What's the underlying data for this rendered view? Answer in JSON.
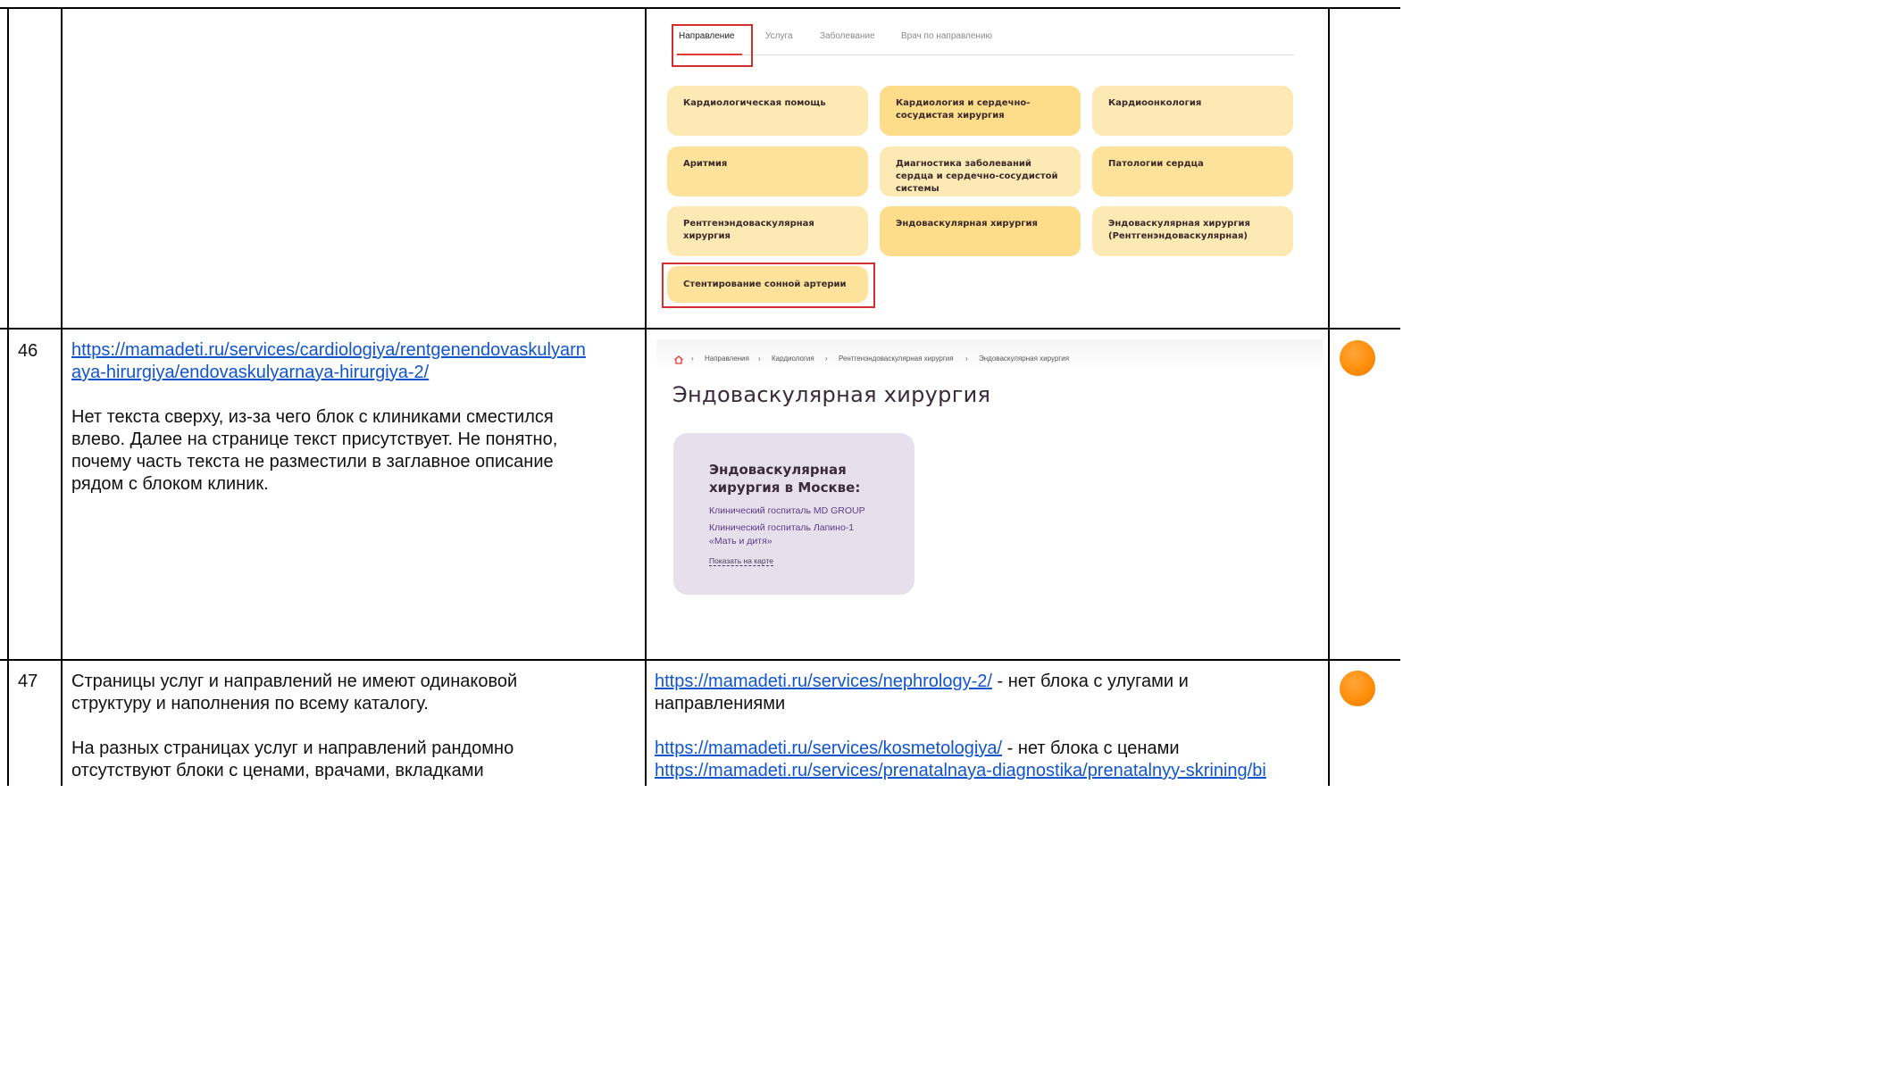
{
  "row_top": {
    "tabs": [
      "Направление",
      "Услуга",
      "Заболевание",
      "Врач по направлению"
    ],
    "chips": [
      "Кардиологическая помощь",
      "Кардиология и сердечно-сосудистая хирургия",
      "Кардиоонкология",
      "Аритмия",
      "Диагностика заболеваний сердца и сердечно-сосудистой системы",
      "Патологии сердца",
      "Рентгенэндоваскулярная хирургия",
      "Эндоваскулярная хирургия",
      "Эндоваскулярная хирургия (Рентгенэндоваскулярная)",
      "Стентирование сонной артерии"
    ]
  },
  "row46": {
    "number": "46",
    "link": "https://mamadeti.ru/services/cardiologiya/rentgenendovaskulyarnaya-hirurgiya/endovaskulyarnaya-hirurgiya-2/",
    "link_line1": "https://mamadeti.ru/services/cardiologiya/rentgenendovaskulyarn",
    "link_line2": "aya-hirurgiya/endovaskulyarnaya-hirurgiya-2/",
    "text_lines": [
      "Нет текста сверху, из-за чего блок с клиниками сместился",
      "влево. Далее на странице текст присутствует. Не понятно,",
      "почему часть текста не разместили в заглавное описание",
      "рядом с блоком клиник."
    ],
    "breadcrumbs": [
      "Направления",
      "Кардиология",
      "Рентгенэндоваскулярная хирургия",
      "Эндоваскулярная хирургия"
    ],
    "heading": "Эндоваскулярная хирургия",
    "card_title_line1": "Эндоваскулярная",
    "card_title_line2": "хирургия в Москве:",
    "clinic1": "Клинический госпиталь MD GROUP",
    "clinic2_line1": "Клинический госпиталь Лапино-1",
    "clinic2_line2": "«Мать и дитя»",
    "map_link": "Показать на карте",
    "status_color": "#ff8f0a"
  },
  "row47": {
    "number": "47",
    "text_lines_1": [
      "Страницы услуг и направлений не имеют одинаковой",
      "структуру и наполнения по всему каталогу."
    ],
    "text_lines_2": [
      "На разных страницах услуг и направлений рандомно",
      "отсутствуют блоки с ценами, врачами, вкладками"
    ],
    "link1": "https://mamadeti.ru/services/nephrology-2/",
    "link1_note": " - нет блока с улугами и",
    "link1_note_line2": "направлениями",
    "link2": "https://mamadeti.ru/services/kosmetologiya/",
    "link2_note": " - нет блока с ценами",
    "link3": "https://mamadeti.ru/services/prenatalnaya-diagnostika/prenatalnyy-skrining/bi",
    "status_color": "#ff8f0a"
  }
}
